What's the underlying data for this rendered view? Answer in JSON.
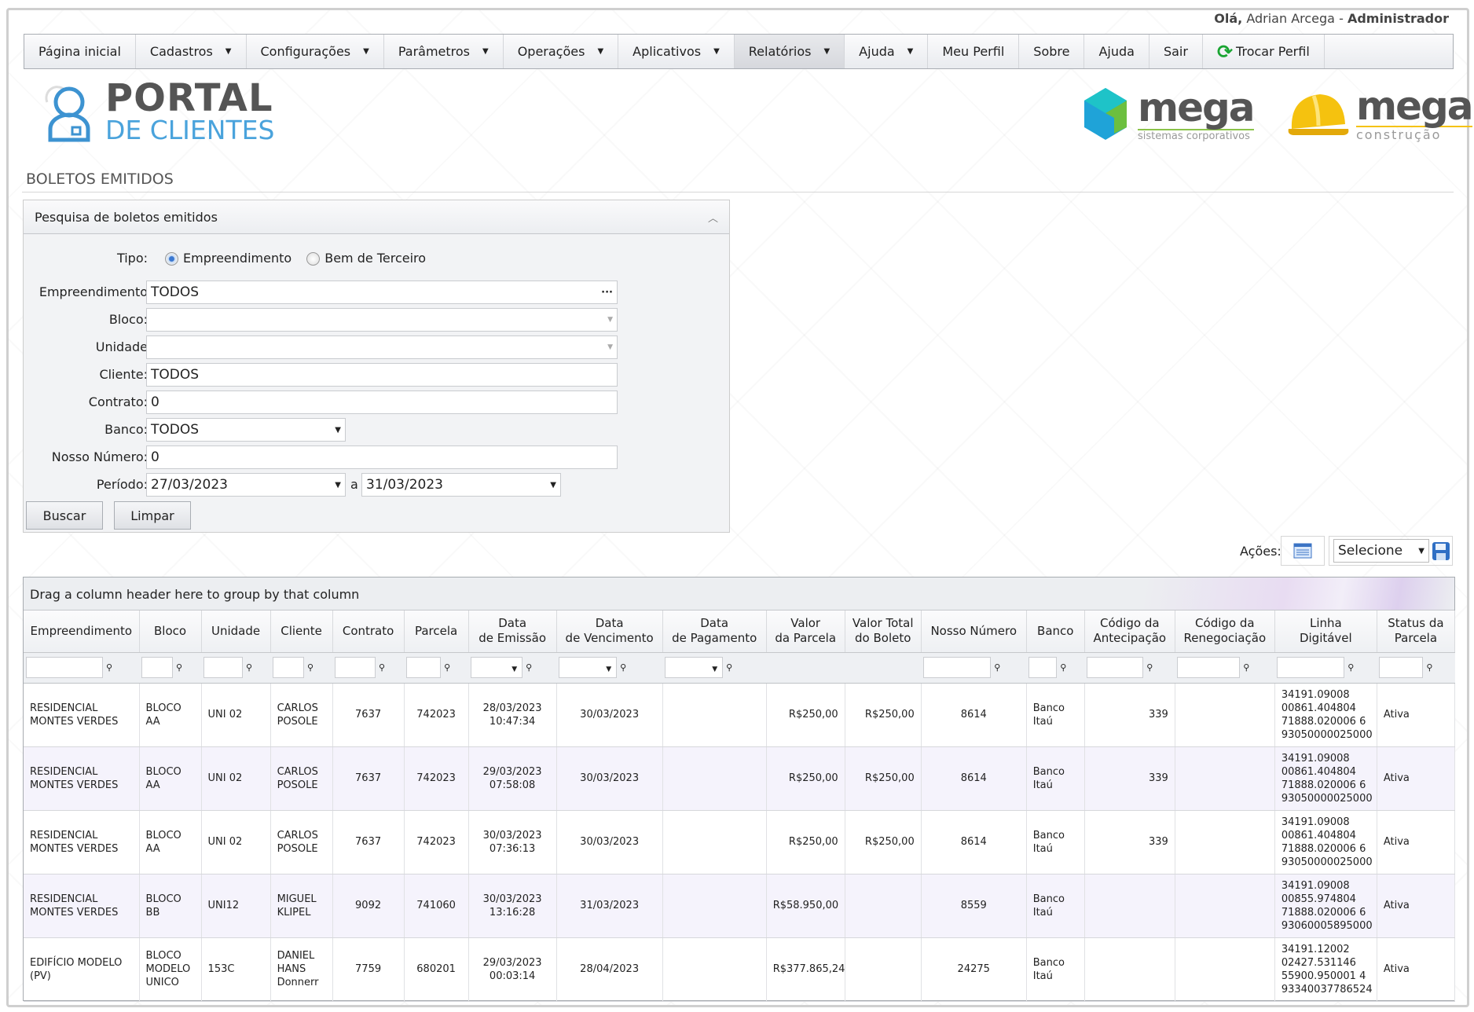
{
  "header": {
    "greeting_prefix": "Olá,",
    "user": "Adrian Arcega",
    "sep": "-",
    "role": "Administrador"
  },
  "nav": [
    {
      "label": "Página inicial",
      "dropdown": false
    },
    {
      "label": "Cadastros",
      "dropdown": true
    },
    {
      "label": "Configurações",
      "dropdown": true
    },
    {
      "label": "Parâmetros",
      "dropdown": true
    },
    {
      "label": "Operações",
      "dropdown": true
    },
    {
      "label": "Aplicativos",
      "dropdown": true
    },
    {
      "label": "Relatórios",
      "dropdown": true,
      "active": true
    },
    {
      "label": "Ajuda",
      "dropdown": true
    },
    {
      "label": "Meu Perfil"
    },
    {
      "label": "Sobre"
    },
    {
      "label": "Ajuda"
    },
    {
      "label": "Sair"
    },
    {
      "label": "Trocar Perfil",
      "icon": "refresh-icon"
    }
  ],
  "logos": {
    "portal_line1": "PORTAL",
    "portal_line2": "DE CLIENTES",
    "mega1_word": "mega",
    "mega1_sub": "sistemas corporativos",
    "mega2_word": "mega",
    "mega2_sub": "construção"
  },
  "page_title": "BOLETOS EMITIDOS",
  "search": {
    "title": "Pesquisa de boletos emitidos",
    "tipo_label": "Tipo:",
    "tipo_options": [
      "Empreendimento",
      "Bem de Terceiro"
    ],
    "tipo_selected": "Empreendimento",
    "empreendimento_label": "Empreendimento",
    "empreendimento_value": "TODOS",
    "bloco_label": "Bloco:",
    "bloco_value": "",
    "unidade_label": "Unidade",
    "unidade_value": "",
    "cliente_label": "Cliente:",
    "cliente_value": "TODOS",
    "contrato_label": "Contrato:",
    "contrato_value": "0",
    "banco_label": "Banco:",
    "banco_value": "TODOS",
    "nosso_label": "Nosso Número:",
    "nosso_value": "0",
    "periodo_label": "Período:",
    "periodo_from": "27/03/2023",
    "periodo_sep": "a",
    "periodo_to": "31/03/2023",
    "buscar": "Buscar",
    "limpar": "Limpar"
  },
  "actions": {
    "label": "Ações:",
    "select_value": "Selecione"
  },
  "grid": {
    "group_hint": "Drag a column header here to group by that column",
    "columns": [
      "Empreendimento",
      "Bloco",
      "Unidade",
      "Cliente",
      "Contrato",
      "Parcela",
      "Data\nde Emissão",
      "Data\nde Vencimento",
      "Data\nde Pagamento",
      "Valor\nda Parcela",
      "Valor Total\ndo Boleto",
      "Nosso Número",
      "Banco",
      "Código da\nAntecipação",
      "Código da\nRenegociação",
      "Linha\nDigitável",
      "Status da\nParcela"
    ],
    "rows": [
      [
        "RESIDENCIAL\nMONTES VERDES",
        "BLOCO\nAA",
        "UNI 02",
        "CARLOS\nPOSOLE",
        "7637",
        "742023",
        "28/03/2023\n10:47:34",
        "30/03/2023",
        "",
        "R$250,00",
        "R$250,00",
        "8614",
        "Banco\nItaú",
        "339",
        "",
        "34191.09008\n00861.404804\n71888.020006 6\n93050000025000",
        "Ativa"
      ],
      [
        "RESIDENCIAL\nMONTES VERDES",
        "BLOCO\nAA",
        "UNI 02",
        "CARLOS\nPOSOLE",
        "7637",
        "742023",
        "29/03/2023\n07:58:08",
        "30/03/2023",
        "",
        "R$250,00",
        "R$250,00",
        "8614",
        "Banco\nItaú",
        "339",
        "",
        "34191.09008\n00861.404804\n71888.020006 6\n93050000025000",
        "Ativa"
      ],
      [
        "RESIDENCIAL\nMONTES VERDES",
        "BLOCO\nAA",
        "UNI 02",
        "CARLOS\nPOSOLE",
        "7637",
        "742023",
        "30/03/2023\n07:36:13",
        "30/03/2023",
        "",
        "R$250,00",
        "R$250,00",
        "8614",
        "Banco\nItaú",
        "339",
        "",
        "34191.09008\n00861.404804\n71888.020006 6\n93050000025000",
        "Ativa"
      ],
      [
        "RESIDENCIAL\nMONTES VERDES",
        "BLOCO\nBB",
        "UNI12",
        "MIGUEL\nKLIPEL",
        "9092",
        "741060",
        "30/03/2023\n13:16:28",
        "31/03/2023",
        "",
        "R$58.950,00",
        "",
        "8559",
        "Banco\nItaú",
        "",
        "",
        "34191.09008\n00855.974804\n71888.020006 6\n93060005895000",
        "Ativa"
      ],
      [
        "EDIFÍCIO MODELO\n(PV)",
        "BLOCO\nMODELO\nUNICO",
        "153C",
        "DANIEL\nHANS\nDonnerr",
        "7759",
        "680201",
        "29/03/2023\n00:03:14",
        "28/04/2023",
        "",
        "R$377.865,24",
        "",
        "24275",
        "Banco\nItaú",
        "",
        "",
        "34191.12002\n02427.531146\n55900.950001 4\n93340037786524",
        "Ativa"
      ]
    ]
  }
}
